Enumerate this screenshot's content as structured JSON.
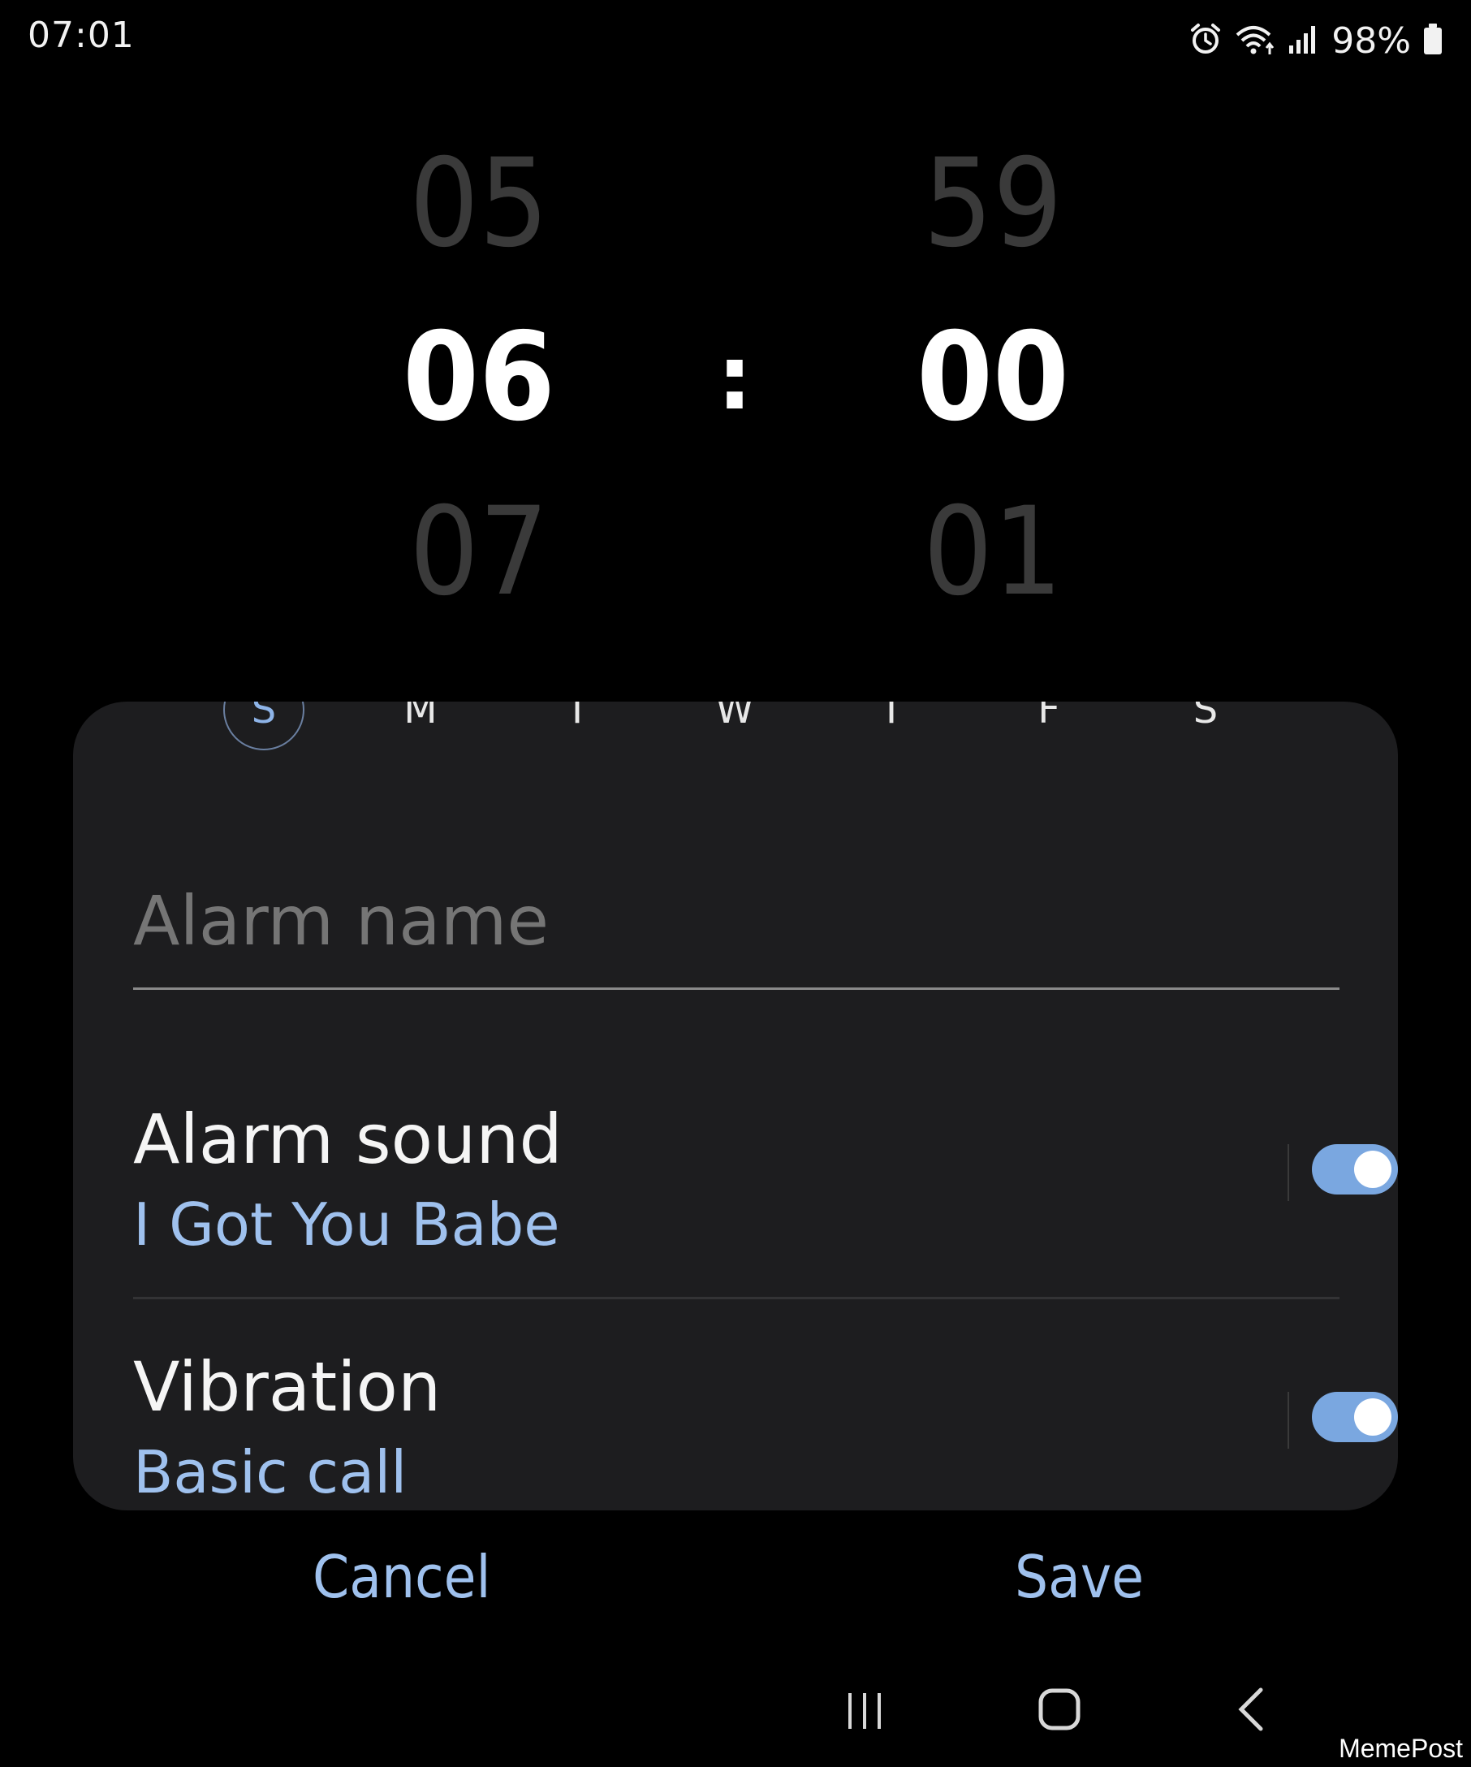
{
  "status_bar": {
    "time": "07:01",
    "battery_percent": "98%",
    "icons": [
      "alarm-icon",
      "wifi-icon",
      "signal-icon",
      "battery-icon"
    ]
  },
  "time_picker": {
    "hours": {
      "prev": "05",
      "current": "06",
      "next": "07"
    },
    "separator": ":",
    "minutes": {
      "prev": "59",
      "current": "00",
      "next": "01"
    }
  },
  "days": [
    {
      "label": "S",
      "selected": true
    },
    {
      "label": "M",
      "selected": false
    },
    {
      "label": "T",
      "selected": false
    },
    {
      "label": "W",
      "selected": false
    },
    {
      "label": "T",
      "selected": false
    },
    {
      "label": "F",
      "selected": false
    },
    {
      "label": "S",
      "selected": false
    }
  ],
  "alarm_name": {
    "placeholder": "Alarm name",
    "value": ""
  },
  "settings": {
    "alarm_sound": {
      "title": "Alarm sound",
      "value": "I Got You Babe",
      "enabled": true
    },
    "vibration": {
      "title": "Vibration",
      "value": "Basic call",
      "enabled": true
    }
  },
  "actions": {
    "cancel_label": "Cancel",
    "save_label": "Save"
  },
  "nav_bar": {
    "buttons": [
      "recents-icon",
      "home-icon",
      "back-icon"
    ]
  },
  "watermark": "MemePost",
  "colors": {
    "background": "#000000",
    "card": "#1d1d1f",
    "accent": "#9fc1ee",
    "toggle_on": "#7aa7e0",
    "faded_digits": "#3a3a3a"
  }
}
